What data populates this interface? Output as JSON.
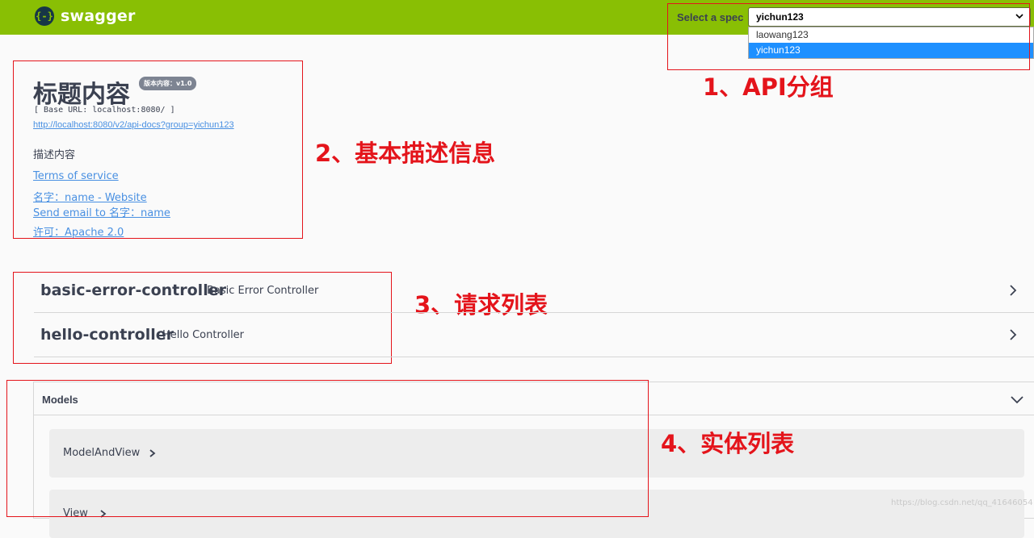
{
  "topbar": {
    "logo_glyph": "{-}",
    "logo_text": "swagger",
    "spec_label": "Select a spec",
    "spec_selected": "yichun123",
    "spec_options": [
      "laowang123",
      "yichun123"
    ]
  },
  "info": {
    "title": "标题内容",
    "version_badge": "版本内容：v1.0",
    "base_url": "[ Base URL: localhost:8080/ ]",
    "doc_link": "http://localhost:8080/v2/api-docs?group=yichun123",
    "description": "描述内容",
    "terms_link": "Terms of service",
    "website_link": "名字：name - Website",
    "email_link": "Send email to 名字：name",
    "license_link": "许可：Apache 2.0"
  },
  "controllers": [
    {
      "name": "basic-error-controller",
      "description": "Basic Error Controller"
    },
    {
      "name": "hello-controller",
      "description": "Hello Controller"
    }
  ],
  "models": {
    "title": "Models",
    "items": [
      "ModelAndView",
      "View"
    ]
  },
  "annotations": {
    "api_group": "1、API分组",
    "basic_info": "2、基本描述信息",
    "request_list": "3、请求列表",
    "entity_list": "4、实体列表"
  },
  "watermark": "https://blog.csdn.net/qq_41646054",
  "colors": {
    "topbar": "#89bf04",
    "annotation": "#e4141b",
    "link": "#4990e2",
    "selected_option": "#1e90ff"
  }
}
